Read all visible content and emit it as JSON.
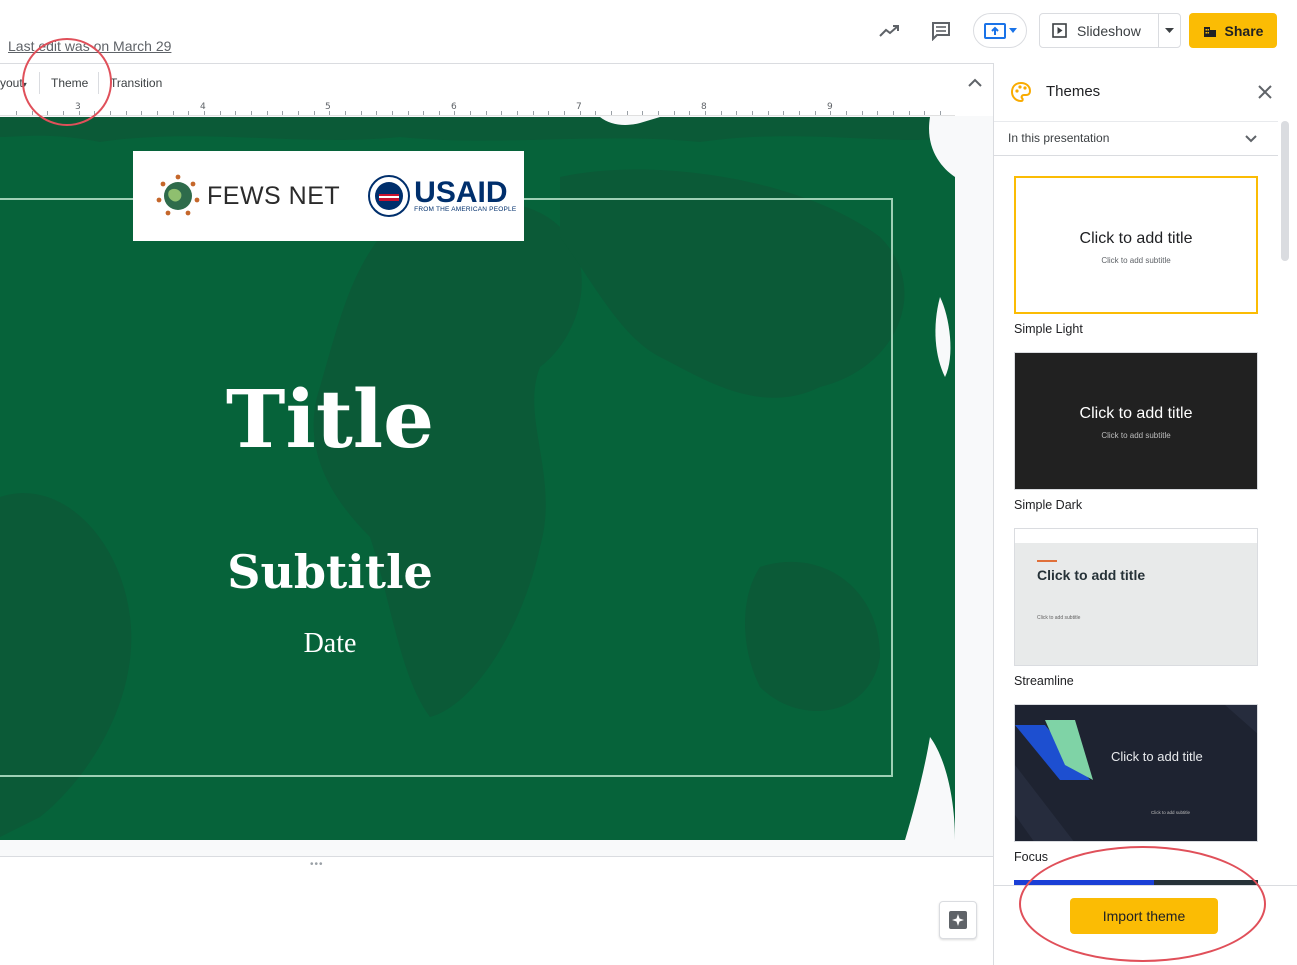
{
  "header": {
    "last_edit": "Last edit was on March 29",
    "slideshow_label": "Slideshow",
    "share_label": "Share"
  },
  "toolbar": {
    "layout_label": "yout",
    "theme_label": "Theme",
    "transition_label": "Transition"
  },
  "ruler": {
    "numbers": [
      "3",
      "4",
      "5",
      "6",
      "7",
      "8",
      "9"
    ]
  },
  "slide": {
    "logo_left_text": "FEWS NET",
    "logo_right_text": "USAID",
    "logo_right_sub": "FROM THE AMERICAN PEOPLE",
    "title": "Title",
    "subtitle": "Subtitle",
    "date": "Date"
  },
  "themes_panel": {
    "title": "Themes",
    "filter_value": "In this presentation",
    "themes": [
      {
        "name": "Simple Light",
        "title": "Click to add title",
        "subtitle": "Click to add subtitle"
      },
      {
        "name": "Simple Dark",
        "title": "Click to add title",
        "subtitle": "Click to add subtitle"
      },
      {
        "name": "Streamline",
        "title": "Click to add title",
        "subtitle": "Click to add subtitle"
      },
      {
        "name": "Focus",
        "title": "Click to add title",
        "subtitle": "Click to add subtitle"
      }
    ],
    "import_label": "Import theme"
  },
  "colors": {
    "accent": "#fbbc04",
    "slide_green": "#06633a",
    "annotation_red": "#e0505a"
  }
}
